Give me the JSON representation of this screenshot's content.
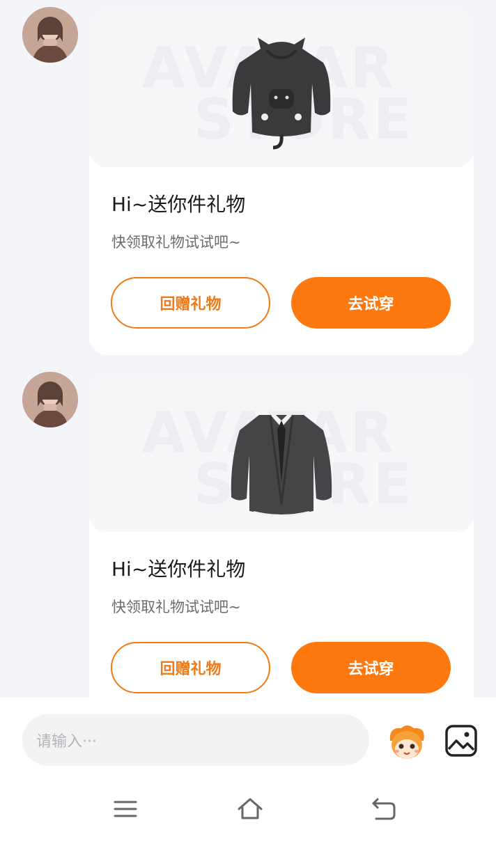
{
  "messages": [
    {
      "sender_avatar": "user-avatar",
      "card": {
        "watermark_line1": "AVATAR",
        "watermark_line2": "STORE",
        "item_image": "black-hoodie-with-cat-ears",
        "title": "Hi~送你件礼物",
        "subtitle": "快领取礼物试试吧~",
        "return_gift_label": "回赠礼物",
        "try_on_label": "去试穿"
      }
    },
    {
      "sender_avatar": "user-avatar",
      "card": {
        "watermark_line1": "AVATAR",
        "watermark_line2": "STORE",
        "item_image": "gray-cardigan-with-tie",
        "title": "Hi~送你件礼物",
        "subtitle": "快领取礼物试试吧~",
        "return_gift_label": "回赠礼物",
        "try_on_label": "去试穿"
      }
    }
  ],
  "composer": {
    "placeholder": "请输入···",
    "emoji_icon": "mascot-face-icon",
    "image_icon": "image-icon"
  },
  "nav": {
    "menu_icon": "menu-icon",
    "home_icon": "home-icon",
    "back_icon": "back-icon"
  },
  "colors": {
    "accent": "#fd780f",
    "background": "#f4f5f9",
    "card": "#ffffff"
  }
}
